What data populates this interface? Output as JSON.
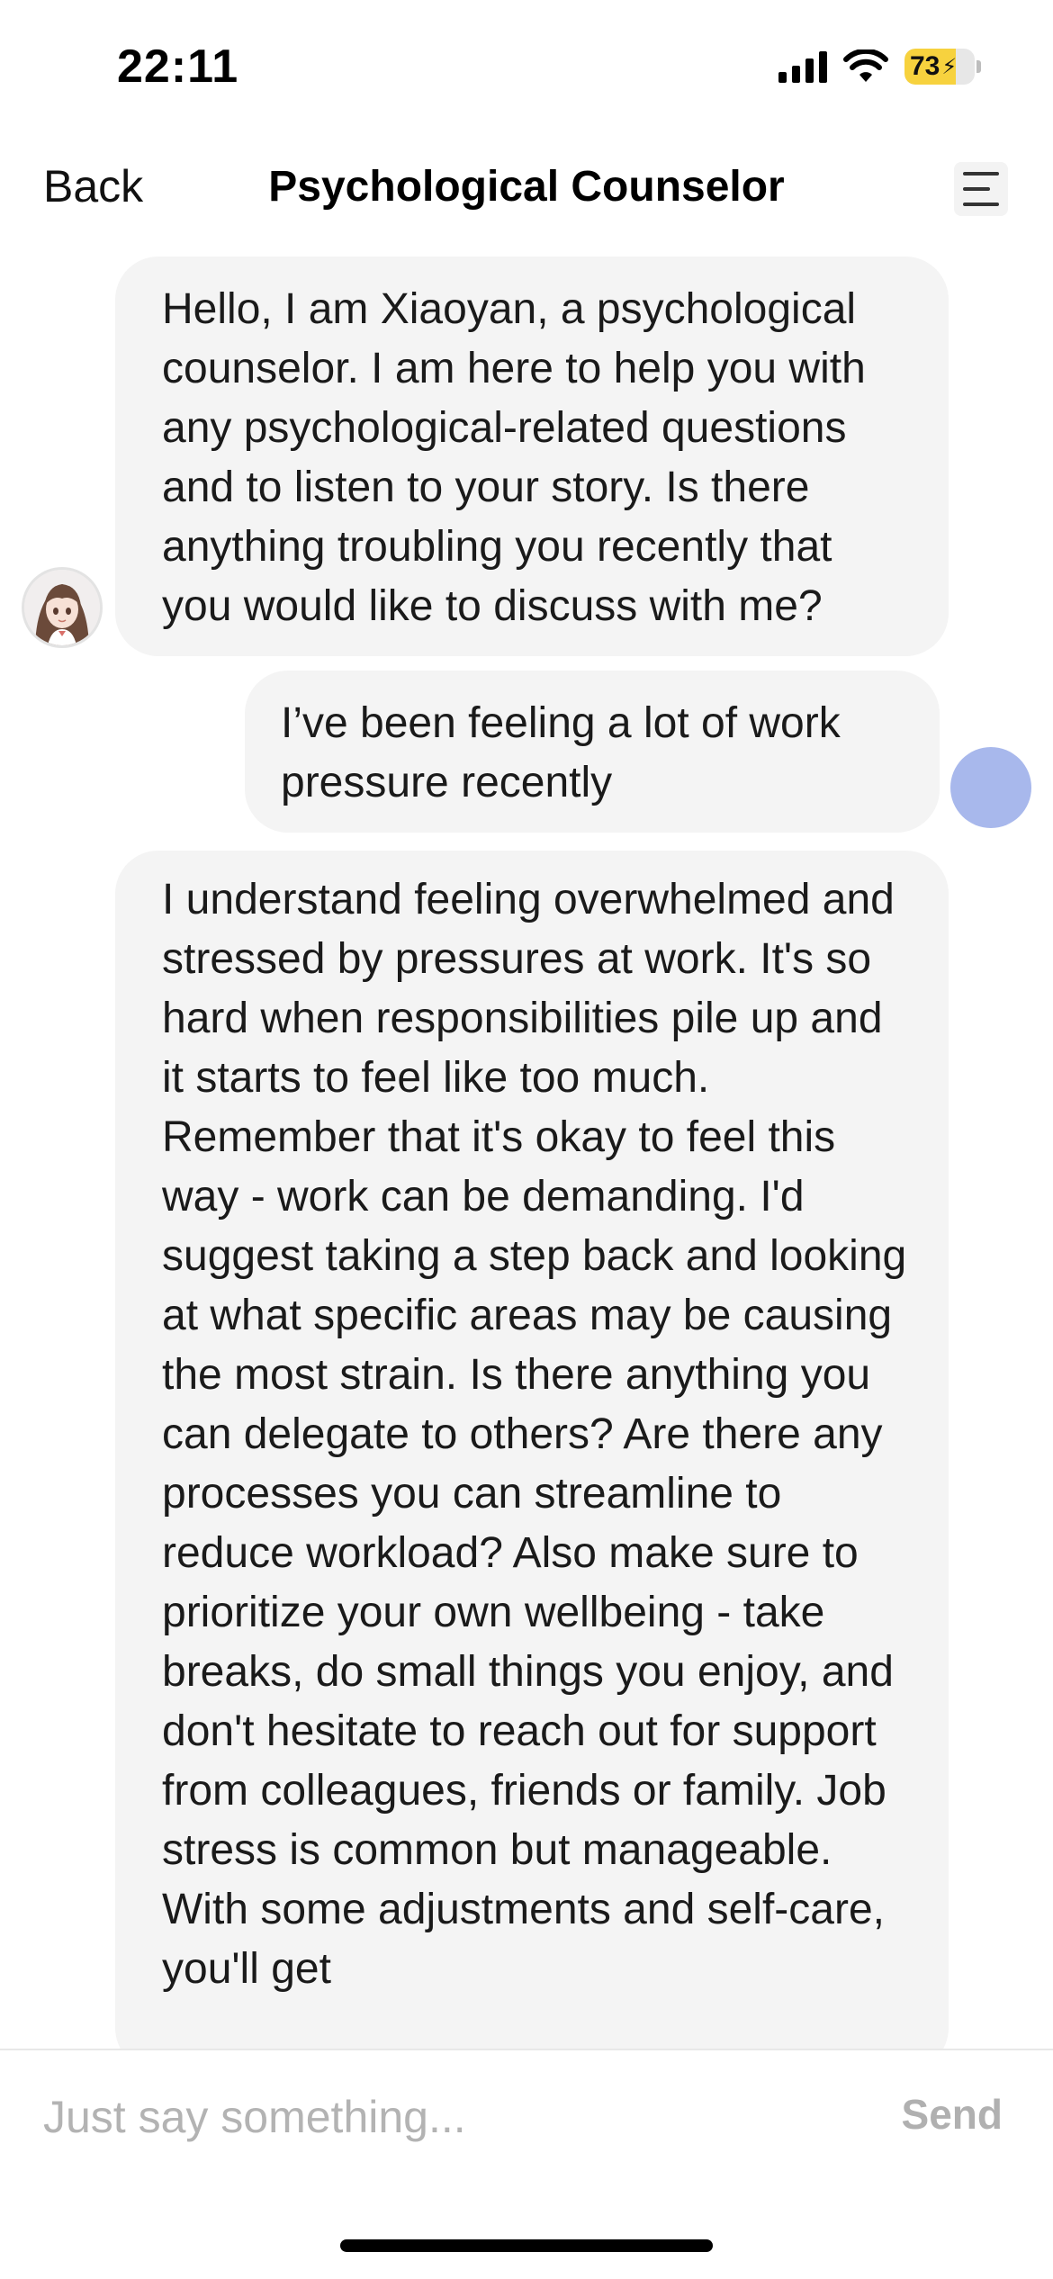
{
  "status_bar": {
    "time": "22:11",
    "battery_level": "73",
    "battery_percent": 73,
    "battery_color": "#f7d23e",
    "icons": [
      "cellular-signal-icon",
      "wifi-icon",
      "battery-charging-icon"
    ]
  },
  "header": {
    "back_label": "Back",
    "title": "Psychological Counselor",
    "menu_icon": "menu-icon"
  },
  "messages": [
    {
      "role": "assistant",
      "text": "Hello, I am Xiaoyan, a psychological counselor. I am here to help you with any psychological-related questions and to listen to your story. Is there anything troubling you recently that you would like to discuss with me?"
    },
    {
      "role": "user",
      "text": "I’ve been feeling a lot of work pressure recently"
    },
    {
      "role": "assistant",
      "text": "I understand feeling overwhelmed and stressed by pressures at work. It's so hard when responsibilities pile up and it starts to feel like too much. Remember that it's okay to feel this way - work can be demanding. I'd suggest taking a step back and looking at what specific areas may be causing the most strain. Is there anything you can delegate to others? Are there any processes you can streamline to reduce workload? Also make sure to prioritize your own wellbeing - take breaks, do small things you enjoy, and don't hesitate to reach out for support from colleagues, friends or family. Job stress is common but manageable. With some adjustments and self-care, you'll get"
    }
  ],
  "input": {
    "placeholder": "Just say something...",
    "value": "",
    "send_label": "Send"
  },
  "colors": {
    "bubble_bg": "#f4f4f4",
    "user_avatar": "#a8b8ec",
    "send_disabled": "#b0b0b0"
  }
}
